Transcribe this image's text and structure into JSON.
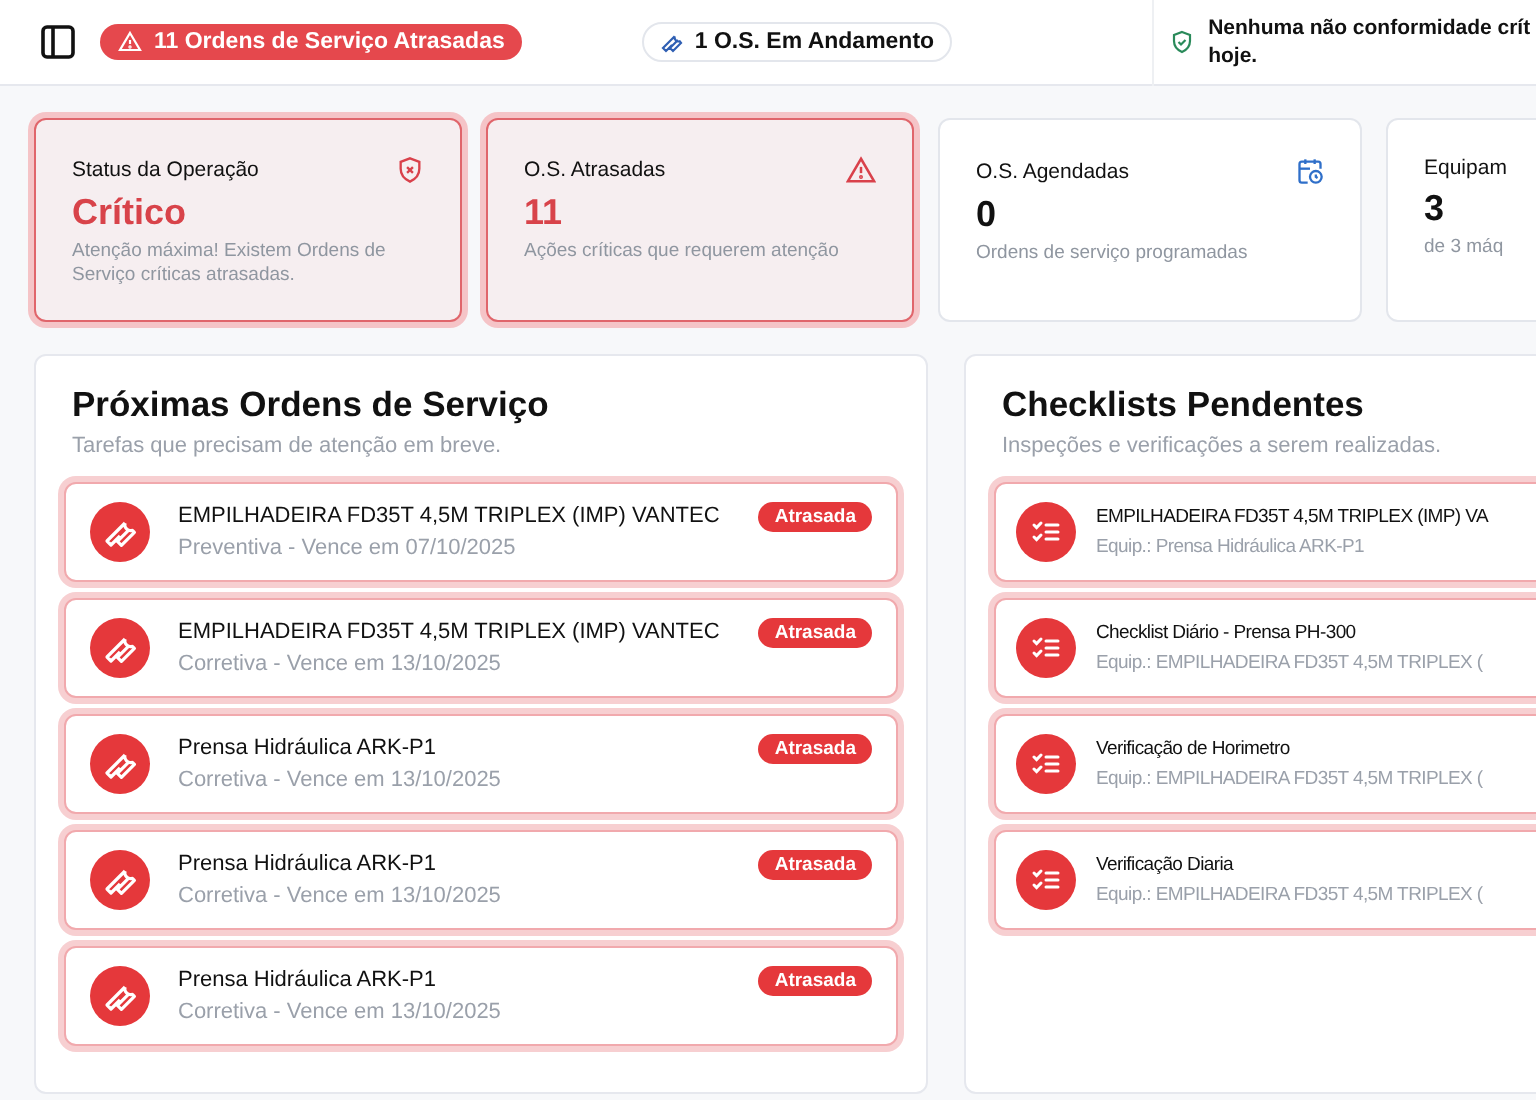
{
  "header": {
    "alert_badge": "11 Ordens de Serviço Atrasadas",
    "progress_chip": "1 O.S. Em Andamento",
    "compliance_lines": [
      "Nenhuma não conformidade crít",
      "hoje."
    ]
  },
  "stat_cards": [
    {
      "title": "Status da Operação",
      "value": "Crítico",
      "caption": "Atenção máxima! Existem Ordens de Serviço críticas atrasadas.",
      "alert": true
    },
    {
      "title": "O.S. Atrasadas",
      "value": "11",
      "caption": "Ações críticas que requerem atenção",
      "alert": true
    },
    {
      "title": "O.S. Agendadas",
      "value": "0",
      "caption": "Ordens de serviço programadas",
      "alert": false
    },
    {
      "title": "Equipam",
      "value": "3",
      "caption": "de 3 máq",
      "alert": false
    }
  ],
  "orders_panel": {
    "title": "Próximas Ordens de Serviço",
    "subtitle": "Tarefas que precisam de atenção em breve.",
    "items": [
      {
        "name": "EMPILHADEIRA FD35T 4,5M TRIPLEX (IMP) VANTEC",
        "detail": "Preventiva - Vence em 07/10/2025",
        "badge": "Atrasada",
        "overdue": true
      },
      {
        "name": "EMPILHADEIRA FD35T 4,5M TRIPLEX (IMP) VANTEC",
        "detail": "Corretiva - Vence em 13/10/2025",
        "badge": "Atrasada",
        "overdue": true
      },
      {
        "name": "Prensa Hidráulica ARK-P1",
        "detail": "Corretiva - Vence em 13/10/2025",
        "badge": "Atrasada",
        "overdue": true
      },
      {
        "name": "Prensa Hidráulica ARK-P1",
        "detail": "Corretiva - Vence em 13/10/2025",
        "badge": "Atrasada",
        "overdue": true
      },
      {
        "name": "Prensa Hidráulica ARK-P1",
        "detail": "Corretiva - Vence em 13/10/2025",
        "badge": "Atrasada",
        "overdue": true
      }
    ]
  },
  "checklists_panel": {
    "title": "Checklists Pendentes",
    "subtitle": "Inspeções e verificações a serem realizadas.",
    "items": [
      {
        "name": "EMPILHADEIRA FD35T 4,5M TRIPLEX (IMP) VA",
        "detail": "Equip.: Prensa Hidráulica ARK-P1",
        "overdue": true
      },
      {
        "name": "Checklist Diário - Prensa PH-300",
        "detail": "Equip.: EMPILHADEIRA FD35T 4,5M TRIPLEX (",
        "overdue": true
      },
      {
        "name": "Verificação de Horimetro",
        "detail": "Equip.: EMPILHADEIRA FD35T 4,5M TRIPLEX (",
        "overdue": true
      },
      {
        "name": "Verificação Diaria",
        "detail": "Equip.: EMPILHADEIRA FD35T 4,5M TRIPLEX (",
        "overdue": true
      }
    ]
  }
}
